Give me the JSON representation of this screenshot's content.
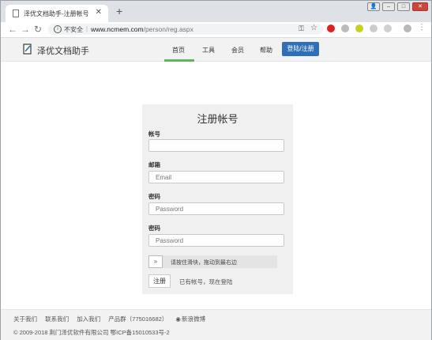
{
  "browser": {
    "tab_title": "泽优文档助手-注册帐号",
    "new_tab": "+",
    "security_label": "不安全",
    "url_host": "www.ncmem.com",
    "url_path": "/person/reg.aspx"
  },
  "site": {
    "logo_text": "泽优文档助手",
    "menu": [
      {
        "label": "首页",
        "active": true
      },
      {
        "label": "工具"
      },
      {
        "label": "会员"
      },
      {
        "label": "帮助"
      }
    ],
    "login_button": "登陆/注册",
    "accent_color": "#5cb85c",
    "button_color": "#2e6fb7"
  },
  "form": {
    "title": "注册帐号",
    "account_label": "帐号",
    "account_value": "",
    "email_label": "邮箱",
    "email_placeholder": "Email",
    "password_label": "密码",
    "password_placeholder": "Password",
    "confirm_label": "密码",
    "confirm_placeholder": "Password",
    "slider_handle": "»",
    "slider_text": "请按住滑块，拖动到最右边",
    "register_button": "注册",
    "login_hint": "已有帐号，现在登陆"
  },
  "footer": {
    "links": [
      "关于我们",
      "联系我们",
      "加入我们",
      "产品群（775016682）",
      "新浪微博"
    ],
    "copyright": "© 2009-2018 荆门泽优软件有限公司 鄂ICP备15010533号-2"
  }
}
